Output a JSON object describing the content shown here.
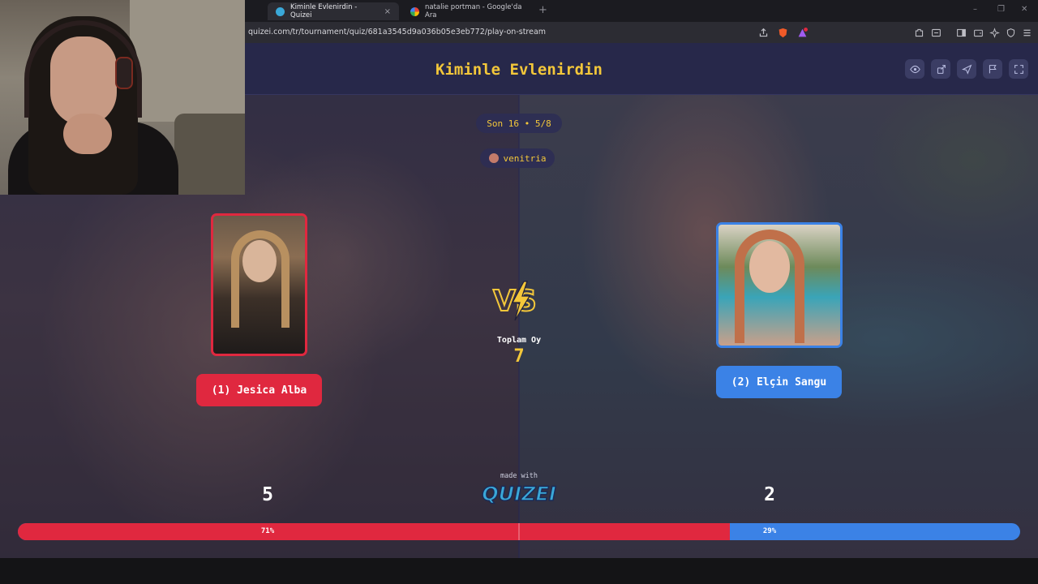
{
  "browser": {
    "tabs": [
      {
        "title": "Kiminle Evlenirdin - Quizei",
        "active": true,
        "close": "×"
      },
      {
        "title": "natalie portman - Google'da Ara",
        "active": false,
        "close": "×"
      }
    ],
    "new_tab": "+",
    "window_controls": {
      "minimize": "–",
      "restore": "❐",
      "close": "✕"
    },
    "url": "quizei.com/tr/tournament/quiz/681a3545d9a036b05e3eb772/play-on-stream"
  },
  "header": {
    "title": "Kiminle Evlenirdin",
    "buttons": [
      "eye-icon",
      "share-icon",
      "send-icon",
      "flag-icon",
      "fullscreen-icon"
    ]
  },
  "round": {
    "label": "Son 16 • 5/8"
  },
  "streamer": {
    "name": "venitria"
  },
  "left": {
    "name": "(1) Jesica Alba",
    "votes": "5",
    "percent": "71%",
    "percent_value": 71,
    "color": "#e0283f"
  },
  "right": {
    "name": "(2) Elçin Sangu",
    "votes": "2",
    "percent": "29%",
    "percent_value": 29,
    "color": "#3b82e6"
  },
  "center": {
    "vs": "VS",
    "total_label": "Toplam Oy",
    "total_value": "7"
  },
  "footer": {
    "made_with": "made with",
    "brand": "QUIZEI"
  },
  "colors": {
    "accent": "#f3c73a",
    "header_bg": "#27284a"
  }
}
